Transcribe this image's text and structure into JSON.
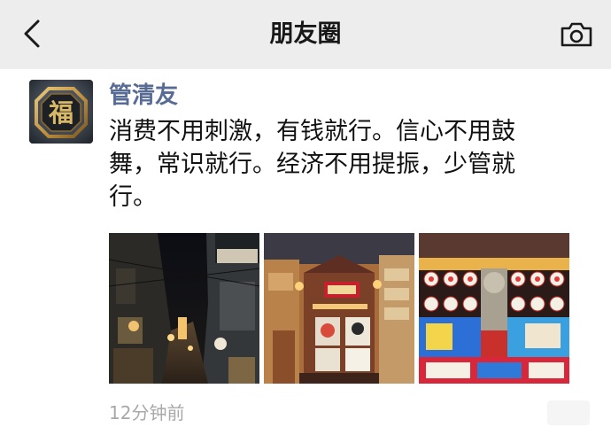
{
  "nav": {
    "title": "朋友圈",
    "back_icon": "chevron-left-icon",
    "camera_icon": "camera-icon"
  },
  "post": {
    "author": "管清友",
    "avatar_char": "福",
    "text": "消费不用刺激，有钱就行。信心不用鼓\n舞，常识就行。经济不用提振，少管就\n行。",
    "time": "12分钟前",
    "images": [
      "night-alley-photo",
      "theater-facade-photo",
      "lantern-sign-photo"
    ]
  },
  "colors": {
    "nav_bg": "#ededed",
    "author": "#576b95",
    "text": "#111111",
    "time": "#a8a8a8"
  }
}
